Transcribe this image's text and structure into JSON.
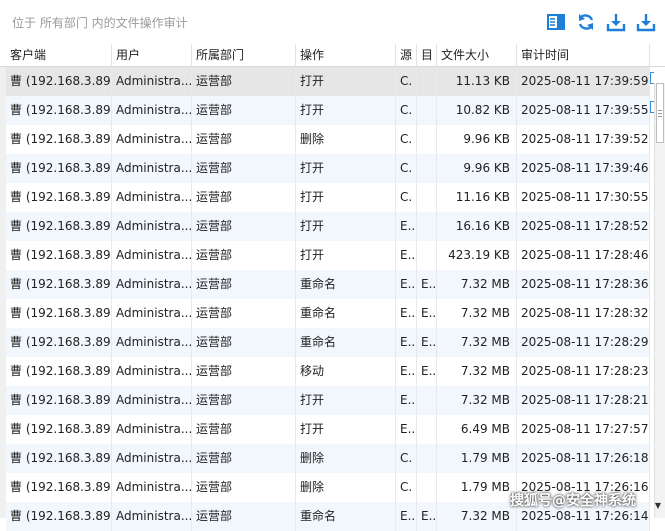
{
  "breadcrumb": "位于 所有部门 内的文件操作审计",
  "toolbar": {
    "icons": [
      "panel-icon",
      "refresh-icon",
      "download-icon",
      "export-icon"
    ],
    "accent": "#1e7fd8"
  },
  "columns": [
    "客户端",
    "用户",
    "所属部门",
    "操作",
    "源",
    "目",
    "文件大小",
    "审计时间"
  ],
  "rows": [
    {
      "client": "曹 (192.168.3.89)",
      "user": "Administra...",
      "dept": "运营部",
      "op": "打开",
      "src": "C.",
      "dst": "",
      "size": "11.13 KB",
      "time": "2025-08-11 17:39:59"
    },
    {
      "client": "曹 (192.168.3.89)",
      "user": "Administra...",
      "dept": "运营部",
      "op": "打开",
      "src": "C.",
      "dst": "",
      "size": "10.82 KB",
      "time": "2025-08-11 17:39:55"
    },
    {
      "client": "曹 (192.168.3.89)",
      "user": "Administra...",
      "dept": "运营部",
      "op": "删除",
      "src": "C.",
      "dst": "",
      "size": "9.96 KB",
      "time": "2025-08-11 17:39:52"
    },
    {
      "client": "曹 (192.168.3.89)",
      "user": "Administra...",
      "dept": "运营部",
      "op": "打开",
      "src": "C.",
      "dst": "",
      "size": "9.96 KB",
      "time": "2025-08-11 17:39:46"
    },
    {
      "client": "曹 (192.168.3.89)",
      "user": "Administra...",
      "dept": "运营部",
      "op": "打开",
      "src": "C.",
      "dst": "",
      "size": "11.16 KB",
      "time": "2025-08-11 17:30:55"
    },
    {
      "client": "曹 (192.168.3.89)",
      "user": "Administra...",
      "dept": "运营部",
      "op": "打开",
      "src": "E..",
      "dst": "",
      "size": "16.16 KB",
      "time": "2025-08-11 17:28:52"
    },
    {
      "client": "曹 (192.168.3.89)",
      "user": "Administra...",
      "dept": "运营部",
      "op": "打开",
      "src": "E..",
      "dst": "",
      "size": "423.19 KB",
      "time": "2025-08-11 17:28:46"
    },
    {
      "client": "曹 (192.168.3.89)",
      "user": "Administra...",
      "dept": "运营部",
      "op": "重命名",
      "src": "E..",
      "dst": "E..",
      "size": "7.32 MB",
      "time": "2025-08-11 17:28:36"
    },
    {
      "client": "曹 (192.168.3.89)",
      "user": "Administra...",
      "dept": "运营部",
      "op": "重命名",
      "src": "E..",
      "dst": "E..",
      "size": "7.32 MB",
      "time": "2025-08-11 17:28:32"
    },
    {
      "client": "曹 (192.168.3.89)",
      "user": "Administra...",
      "dept": "运营部",
      "op": "重命名",
      "src": "E..",
      "dst": "E..",
      "size": "7.32 MB",
      "time": "2025-08-11 17:28:29"
    },
    {
      "client": "曹 (192.168.3.89)",
      "user": "Administra...",
      "dept": "运营部",
      "op": "移动",
      "src": "E..",
      "dst": "E..",
      "size": "7.32 MB",
      "time": "2025-08-11 17:28:23"
    },
    {
      "client": "曹 (192.168.3.89)",
      "user": "Administra...",
      "dept": "运营部",
      "op": "打开",
      "src": "E..",
      "dst": "",
      "size": "7.32 MB",
      "time": "2025-08-11 17:28:21"
    },
    {
      "client": "曹 (192.168.3.89)",
      "user": "Administra...",
      "dept": "运营部",
      "op": "打开",
      "src": "E..",
      "dst": "",
      "size": "6.49 MB",
      "time": "2025-08-11 17:27:57"
    },
    {
      "client": "曹 (192.168.3.89)",
      "user": "Administra...",
      "dept": "运营部",
      "op": "删除",
      "src": "C.",
      "dst": "",
      "size": "1.79 MB",
      "time": "2025-08-11 17:26:18"
    },
    {
      "client": "曹 (192.168.3.89)",
      "user": "Administra...",
      "dept": "运营部",
      "op": "删除",
      "src": "C.",
      "dst": "",
      "size": "1.79 MB",
      "time": "2025-08-11 17:26:16"
    },
    {
      "client": "曹 (192.168.3.89)",
      "user": "Administra...",
      "dept": "运营部",
      "op": "重命名",
      "src": "E..",
      "dst": "E..",
      "size": "7.32 MB",
      "time": "2025-08-11 17:26:14"
    }
  ],
  "selected_row": 0,
  "watermark": "搜狐号@安全神系统"
}
